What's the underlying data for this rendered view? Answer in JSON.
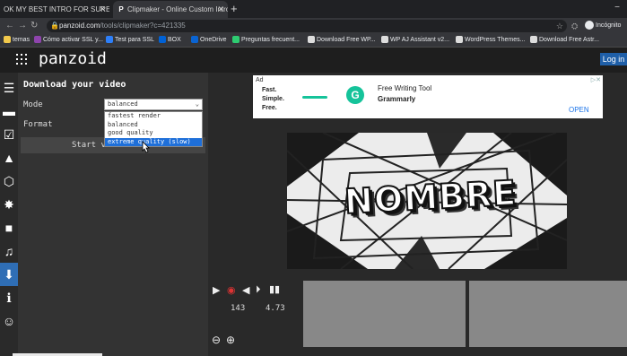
{
  "browser": {
    "tabs": [
      {
        "title": "OK MY BEST INTRO FOR SURE O..."
      },
      {
        "title": "Clipmaker - Online Custom Intro..."
      }
    ],
    "url_domain": "panzoid.com",
    "url_path": "/tools/clipmaker?c=421335",
    "profile_label": "Incógnito",
    "bookmarks": [
      {
        "label": "temas",
        "color": "#f2c94c"
      },
      {
        "label": "Cómo activar SSL y...",
        "color": "#8e44ad"
      },
      {
        "label": "Test para SSL",
        "color": "#2d7ff9"
      },
      {
        "label": "BOX",
        "color": "#0061d5"
      },
      {
        "label": "OneDrive",
        "color": "#0a64d3"
      },
      {
        "label": "Preguntas frecuent...",
        "color": "#2ecc71"
      },
      {
        "label": "Download Free WP...",
        "color": "#dddddd"
      },
      {
        "label": "WP AJ Assistant v2...",
        "color": "#dddddd"
      },
      {
        "label": "WordPress Themes...",
        "color": "#dddddd"
      },
      {
        "label": "Download Free Astr...",
        "color": "#dddddd"
      }
    ]
  },
  "app": {
    "brand": "panzoid",
    "login_label": "Log in",
    "panel": {
      "title": "Download your video",
      "mode_label": "Mode",
      "mode_value": "balanced",
      "format_label": "Format",
      "start_label": "Start video re...",
      "options": [
        "fastest render",
        "balanced",
        "good quality",
        "extreme quality (slow)"
      ],
      "highlighted_option": "extreme quality (slow)"
    },
    "ad": {
      "badge": "Ad",
      "taglines": [
        "Fast.",
        "Simple.",
        "Free."
      ],
      "headline": "Free Writing Tool",
      "sponsor": "Grammarly",
      "cta": "OPEN",
      "logo_letter": "G"
    },
    "preview_text": "NOMBRE",
    "playback": {
      "frame": "143",
      "time": "4.73"
    },
    "colors": {
      "accent": "#2f6eb5",
      "dropdown_highlight": "#1e6fd9",
      "grammarly": "#15c39a"
    }
  }
}
